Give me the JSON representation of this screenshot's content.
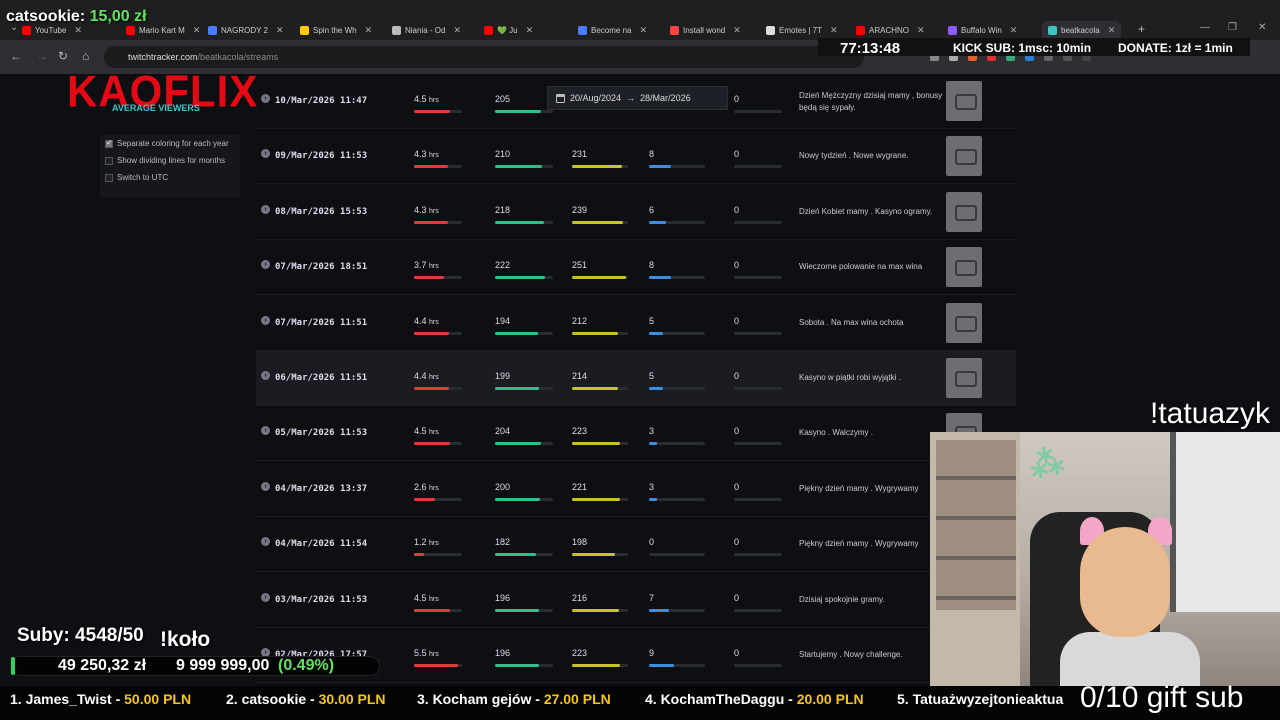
{
  "browser": {
    "tabs": [
      {
        "label": "YouTube",
        "color": "#ff0000"
      },
      {
        "label": "Mario Kart M",
        "color": "#ff0000"
      },
      {
        "label": "NAGRODY 2",
        "color": "#4a7dff"
      },
      {
        "label": "Spin the Wh",
        "color": "#ffcc00"
      },
      {
        "label": "Niania - Od",
        "color": "#bbbbbb"
      },
      {
        "label": "💚 Ju",
        "color": "#ff0000"
      },
      {
        "label": "Become na",
        "color": "#4a7dff"
      },
      {
        "label": "Install wond",
        "color": "#ff4444"
      },
      {
        "label": "Emotes | 7T",
        "color": "#dddddd"
      },
      {
        "label": "ARACHNO",
        "color": "#ff0000"
      },
      {
        "label": "Buffalo Win",
        "color": "#8a5cff"
      },
      {
        "label": "beatkacola",
        "color": "#3cc6c6"
      }
    ],
    "url_host": "twitchtracker.com",
    "url_path": "/beatkacola/streams"
  },
  "overlay": {
    "top_donor_name": "catsookie:",
    "top_donor_amount": "15,00 zł",
    "timer": "77:13:48",
    "kick_sub": "KICK SUB: 1msc: 10min",
    "donate": "DONATE: 1zł = 1min",
    "tatuazyk": "!tatuazyk",
    "subs": "Suby: 4548/50",
    "kolo": "!koło",
    "goal_current": "49 250,32 zł",
    "goal_target": "9 999 999,00",
    "goal_percent": "(0.49%)",
    "goal_fraction": 0.0049,
    "gift_sub": "0/10 gift sub",
    "ticker": [
      {
        "name": "1. James_Twist - ",
        "amount": "50.00 PLN"
      },
      {
        "name": "2. catsookie - ",
        "amount": "30.00 PLN"
      },
      {
        "name": "3. Kocham gejów - ",
        "amount": "27.00 PLN"
      },
      {
        "name": "4. KochamTheDaggu - ",
        "amount": "20.00 PLN"
      },
      {
        "name": "5. Tatuażwyzejtonieaktua",
        "amount": ""
      }
    ]
  },
  "sidebar": {
    "logo": "KAOFLIX",
    "avg_viewers_label": "AVERAGE VIEWERS",
    "options": [
      {
        "label": "Separate coloring for each year",
        "checked": true
      },
      {
        "label": "Show dividing lines for months",
        "checked": false
      },
      {
        "label": "Switch to UTC",
        "checked": false
      }
    ]
  },
  "date_range": {
    "from": "20/Aug/2024",
    "arrow": "→",
    "to": "28/Mar/2026"
  },
  "streams": [
    {
      "date": "10/Mar/2026 11:47",
      "hours": "4.5",
      "unit": "hrs",
      "avg": "205",
      "peak": "",
      "followers": "",
      "views": "0",
      "title": "Dzień Mężczyzny dzisiaj mamy , bonusy będą się sypały."
    },
    {
      "date": "09/Mar/2026 11:53",
      "hours": "4.3",
      "unit": "hrs",
      "avg": "210",
      "peak": "231",
      "followers": "8",
      "views": "0",
      "title": "Nowy tydzień . Nowe wygrane."
    },
    {
      "date": "08/Mar/2026 15:53",
      "hours": "4.3",
      "unit": "hrs",
      "avg": "218",
      "peak": "239",
      "followers": "6",
      "views": "0",
      "title": "Dzień Kobiet mamy . Kasyno ogramy."
    },
    {
      "date": "07/Mar/2026 18:51",
      "hours": "3.7",
      "unit": "hrs",
      "avg": "222",
      "peak": "251",
      "followers": "8",
      "views": "0",
      "title": "Wieczorne polowanie na max wina"
    },
    {
      "date": "07/Mar/2026 11:51",
      "hours": "4.4",
      "unit": "hrs",
      "avg": "194",
      "peak": "212",
      "followers": "5",
      "views": "0",
      "title": "Sobota . Na max wina ochota"
    },
    {
      "date": "06/Mar/2026 11:51",
      "hours": "4.4",
      "unit": "hrs",
      "avg": "199",
      "peak": "214",
      "followers": "5",
      "views": "0",
      "title": "Kasyno w piątki robi wyjątki ."
    },
    {
      "date": "05/Mar/2026 11:53",
      "hours": "4.5",
      "unit": "hrs",
      "avg": "204",
      "peak": "223",
      "followers": "3",
      "views": "0",
      "title": "Kasyno . Walczymy ."
    },
    {
      "date": "04/Mar/2026 13:37",
      "hours": "2.6",
      "unit": "hrs",
      "avg": "200",
      "peak": "221",
      "followers": "3",
      "views": "0",
      "title": "Piękny dzień mamy . Wygrywamy"
    },
    {
      "date": "04/Mar/2026 11:54",
      "hours": "1.2",
      "unit": "hrs",
      "avg": "182",
      "peak": "198",
      "followers": "0",
      "views": "0",
      "title": "Piękny dzień mamy . Wygrywamy"
    },
    {
      "date": "03/Mar/2026 11:53",
      "hours": "4.5",
      "unit": "hrs",
      "avg": "196",
      "peak": "216",
      "followers": "7",
      "views": "0",
      "title": "Dzisiaj spokojnie gramy."
    },
    {
      "date": "02/Mar/2026 17:57",
      "hours": "5.5",
      "unit": "hrs",
      "avg": "196",
      "peak": "223",
      "followers": "9",
      "views": "0",
      "title": "Startujemy . Nowy challenge."
    }
  ],
  "colors": {
    "duration": "#e03a3a",
    "avg": "#2fc08a",
    "peak": "#c9c42a",
    "followers": "#3a8fe0"
  }
}
